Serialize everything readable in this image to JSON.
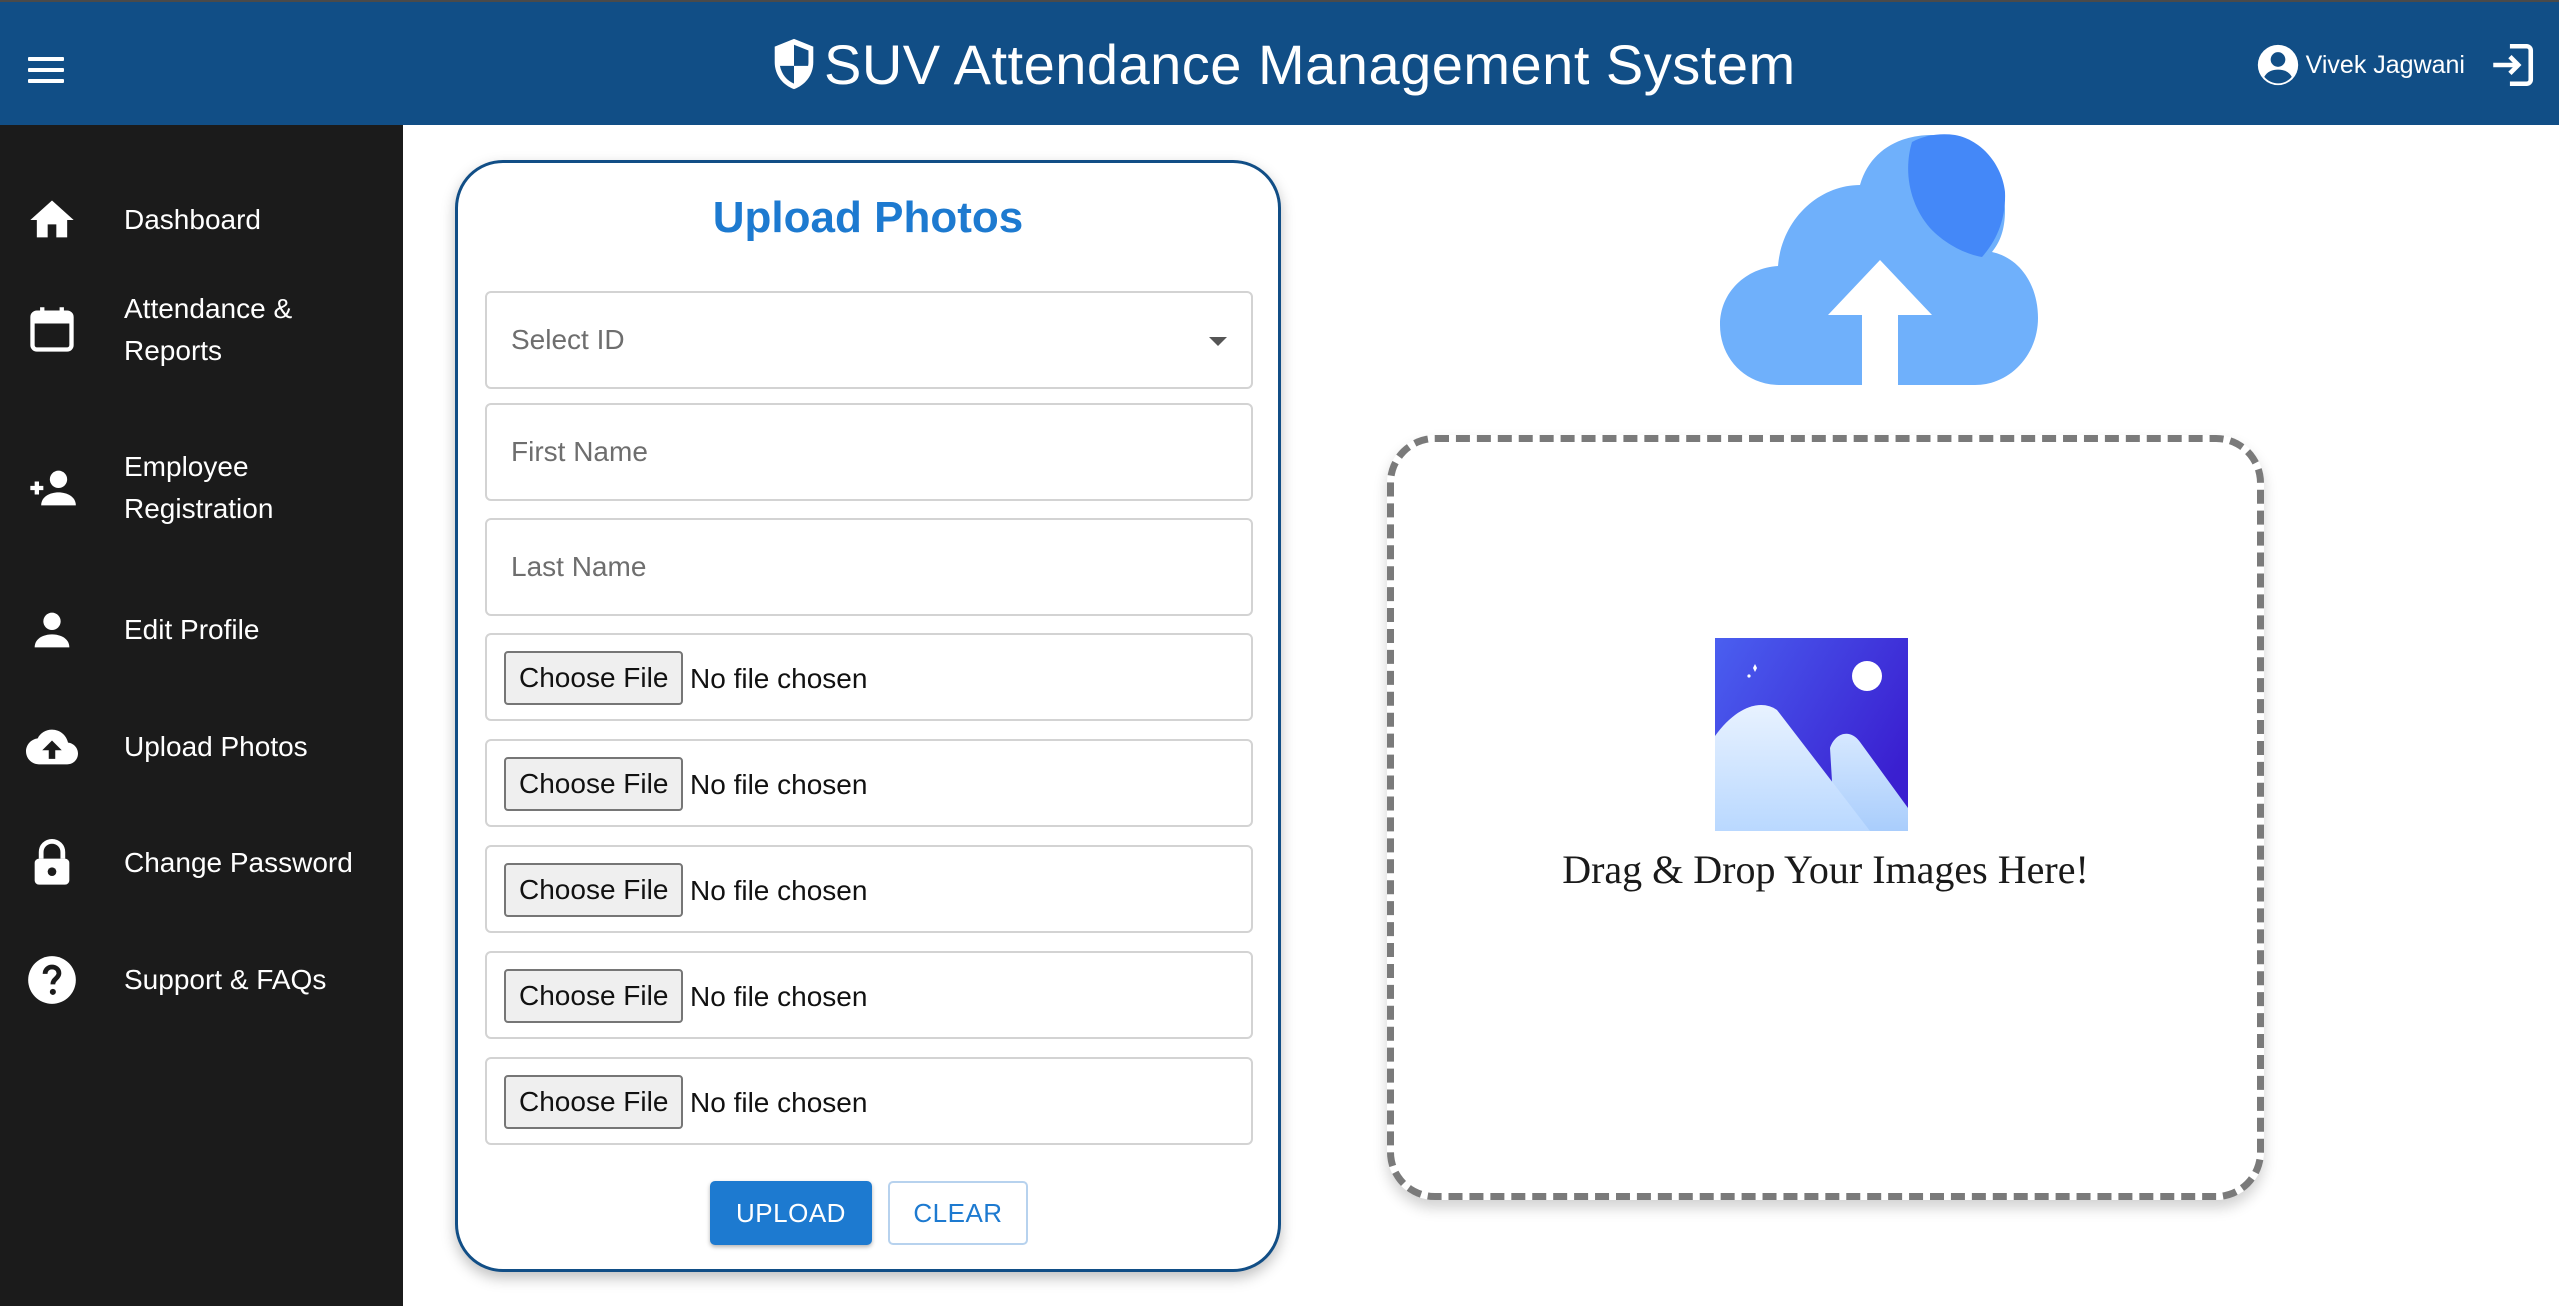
{
  "header": {
    "title": "SUV Attendance Management System",
    "user_name": "Vivek Jagwani",
    "bg_color": "#114e86"
  },
  "sidebar": {
    "items": [
      {
        "label": "Dashboard",
        "icon": "home-icon"
      },
      {
        "label": "Attendance & Reports",
        "icon": "calendar-icon"
      },
      {
        "label": "Employee Registration",
        "icon": "person-add-icon"
      },
      {
        "label": "Edit Profile",
        "icon": "person-icon"
      },
      {
        "label": "Upload Photos",
        "icon": "cloud-upload-icon"
      },
      {
        "label": "Change Password",
        "icon": "lock-icon"
      },
      {
        "label": "Support & FAQs",
        "icon": "help-icon"
      }
    ]
  },
  "form": {
    "title": "Upload Photos",
    "select_id_placeholder": "Select ID",
    "first_name_placeholder": "First Name",
    "last_name_placeholder": "Last Name",
    "files": [
      {
        "button": "Choose File",
        "status": "No file chosen"
      },
      {
        "button": "Choose File",
        "status": "No file chosen"
      },
      {
        "button": "Choose File",
        "status": "No file chosen"
      },
      {
        "button": "Choose File",
        "status": "No file chosen"
      },
      {
        "button": "Choose File",
        "status": "No file chosen"
      }
    ],
    "upload_label": "UPLOAD",
    "clear_label": "CLEAR",
    "accent_color": "#1d7ad0"
  },
  "dropzone": {
    "text": "Drag & Drop Your Images Here!"
  }
}
